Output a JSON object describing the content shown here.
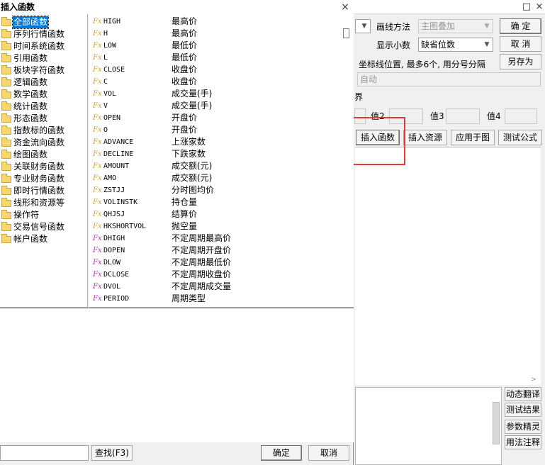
{
  "dialog": {
    "title": "插入函数",
    "close_glyph": "×",
    "categories": [
      "全部函数",
      "序列行情函数",
      "时间系统函数",
      "引用函数",
      "板块字符函数",
      "逻辑函数",
      "数学函数",
      "统计函数",
      "形态函数",
      "指数标的函数",
      "资金流向函数",
      "绘图函数",
      "关联财务函数",
      "专业财务函数",
      "即时行情函数",
      "线形和资源等",
      "操作符",
      "交易信号函数",
      "帐户函数"
    ],
    "selected_category": "全部函数",
    "functions": [
      {
        "icon": "Fx",
        "name": "HIGH",
        "desc": "最高价"
      },
      {
        "icon": "Fx",
        "name": "H",
        "desc": "最高价"
      },
      {
        "icon": "Fx",
        "name": "LOW",
        "desc": "最低价"
      },
      {
        "icon": "Fx",
        "name": "L",
        "desc": "最低价"
      },
      {
        "icon": "Fx",
        "name": "CLOSE",
        "desc": "收盘价"
      },
      {
        "icon": "Fx",
        "name": "C",
        "desc": "收盘价"
      },
      {
        "icon": "Fx",
        "name": "VOL",
        "desc": "成交量(手)"
      },
      {
        "icon": "Fx",
        "name": "V",
        "desc": "成交量(手)"
      },
      {
        "icon": "Fx",
        "name": "OPEN",
        "desc": "开盘价"
      },
      {
        "icon": "Fx",
        "name": "O",
        "desc": "开盘价"
      },
      {
        "icon": "Fx",
        "name": "ADVANCE",
        "desc": "上涨家数"
      },
      {
        "icon": "Fx",
        "name": "DECLINE",
        "desc": "下跌家数"
      },
      {
        "icon": "Fx",
        "name": "AMOUNT",
        "desc": "成交额(元)"
      },
      {
        "icon": "Fx",
        "name": "AMO",
        "desc": "成交额(元)"
      },
      {
        "icon": "Fx",
        "name": "ZSTJJ",
        "desc": "分时图均价"
      },
      {
        "icon": "Fx",
        "name": "VOLINSTK",
        "desc": "持仓量"
      },
      {
        "icon": "Fx",
        "name": "QHJSJ",
        "desc": "结算价"
      },
      {
        "icon": "Fx",
        "name": "HKSHORTVOL",
        "desc": "抛空量"
      },
      {
        "icon": "Fx",
        "name": "DHIGH",
        "desc": "不定周期最高价"
      },
      {
        "icon": "Fx",
        "name": "DOPEN",
        "desc": "不定周期开盘价"
      },
      {
        "icon": "Fx",
        "name": "DLOW",
        "desc": "不定周期最低价"
      },
      {
        "icon": "Fx",
        "name": "DCLOSE",
        "desc": "不定周期收盘价"
      },
      {
        "icon": "Fx",
        "name": "DVOL",
        "desc": "不定周期成交量"
      },
      {
        "icon": "Fx",
        "name": "PERIOD",
        "desc": "周期类型"
      }
    ],
    "search_value": "",
    "search_button": "查找(F3)",
    "ok_button": "确定",
    "cancel_button": "取消"
  },
  "editor": {
    "titlebar_glyphs": {
      "maximize": "□",
      "close": "×"
    },
    "draw_method_label": "画线方法",
    "draw_method_value": "主图叠加",
    "decimal_label": "显示小数",
    "decimal_value": "缺省位数",
    "ok_button": "确  定",
    "cancel_button": "取  消",
    "save_as_button": "另存为",
    "axis_label": "坐标线位置, 最多6个, 用分号分隔",
    "axis_value": "自动",
    "bounds_label": "界",
    "value2_label": "值2",
    "value3_label": "值3",
    "value4_label": "值4",
    "insert_function_button": "插入函数",
    "insert_resource_button": "插入资源",
    "apply_to_chart_button": "应用于图",
    "test_formula_button": "测试公式",
    "side_buttons": [
      "动态翻译",
      "测试结果",
      "参数精灵",
      "用法注释"
    ],
    "scroll_glyph": ">"
  },
  "colors": {
    "highlight": "#e53935",
    "selection": "#0078d7",
    "fx_icon": "#c9a43c",
    "fx_icon_special": "#c02fc0"
  }
}
